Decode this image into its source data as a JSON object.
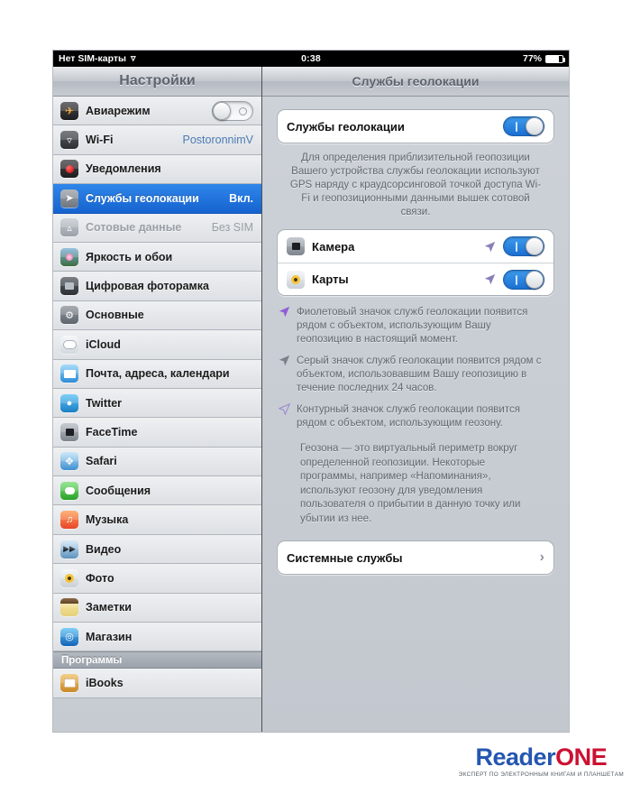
{
  "statusbar": {
    "carrier": "Нет SIM-карты",
    "wifi_icon": "wifi-icon",
    "time": "0:38",
    "battery_percent": "77%"
  },
  "sidebar": {
    "title": "Настройки",
    "items": [
      {
        "label": "Авиарежим",
        "icon": "airplane-icon",
        "control": "toggle",
        "toggle_on": false
      },
      {
        "label": "Wi-Fi",
        "icon": "wifi-icon",
        "value": "PostoronnimV"
      },
      {
        "label": "Уведомления",
        "icon": "notifications-icon"
      },
      {
        "label": "Службы геолокации",
        "icon": "location-icon",
        "value": "Вкл.",
        "selected": true
      },
      {
        "label": "Сотовые данные",
        "icon": "cellular-icon",
        "value": "Без SIM",
        "disabled": true
      },
      {
        "label": "Яркость и обои",
        "icon": "brightness-icon"
      },
      {
        "label": "Цифровая фоторамка",
        "icon": "picture-frame-icon"
      },
      {
        "label": "Основные",
        "icon": "general-gear-icon"
      },
      {
        "label": "iCloud",
        "icon": "icloud-icon"
      },
      {
        "label": "Почта, адреса, календари",
        "icon": "mail-icon"
      },
      {
        "label": "Twitter",
        "icon": "twitter-icon"
      },
      {
        "label": "FaceTime",
        "icon": "facetime-icon"
      },
      {
        "label": "Safari",
        "icon": "safari-icon"
      },
      {
        "label": "Сообщения",
        "icon": "messages-icon"
      },
      {
        "label": "Музыка",
        "icon": "music-icon"
      },
      {
        "label": "Видео",
        "icon": "video-icon"
      },
      {
        "label": "Фото",
        "icon": "photos-icon"
      },
      {
        "label": "Заметки",
        "icon": "notes-icon"
      },
      {
        "label": "Магазин",
        "icon": "store-icon"
      }
    ],
    "group_header": "Программы",
    "apps": [
      {
        "label": "iBooks",
        "icon": "ibooks-icon"
      }
    ]
  },
  "detail": {
    "title": "Службы геолокации",
    "master_row": {
      "label": "Службы геолокации",
      "toggle_on": true
    },
    "description": "Для определения приблизительной геопозиции Вашего устройства службы геолокации используют GPS наряду с краудсорсинговой точкой доступа Wi-Fi и геопозиционными данными вышек сотовой связи.",
    "app_rows": [
      {
        "label": "Камера",
        "icon": "camera-icon",
        "indicator": "location-arrow-purple",
        "toggle_on": true
      },
      {
        "label": "Карты",
        "icon": "maps-icon",
        "indicator": "location-arrow-purple",
        "toggle_on": true
      }
    ],
    "bullets": [
      {
        "indicator": "location-arrow-purple-filled",
        "text": "Фиолетовый значок служб геолокации появится рядом с объектом, использующим Вашу геопозицию в настоящий момент."
      },
      {
        "indicator": "location-arrow-gray-filled",
        "text": "Серый значок служб геолокации появится рядом с объектом, использовавшим Вашу геопозицию в течение последних 24 часов."
      },
      {
        "indicator": "location-arrow-outline",
        "text": "Контурный значок служб геолокации появится рядом с объектом, использующим геозону."
      }
    ],
    "geofence_note": "Геозона — это виртуальный периметр вокруг определенной геопозиции. Некоторые программы, например «Напоминания», используют геозону для уведомления пользователя о прибытии в данную точку или убытии из нее.",
    "system_services": {
      "label": "Системные службы",
      "chevron": "chevron-right-icon"
    }
  },
  "watermark": {
    "brand_first": "Reader",
    "brand_second": "ONE",
    "tagline": "ЭКСПЕРТ ПО ЭЛЕКТРОННЫМ КНИГАМ И ПЛАНШЕТАМ"
  },
  "colors": {
    "selection_blue": "#1663cf",
    "toggle_on_blue": "#1b6fd1",
    "value_blue": "#4e7bb5",
    "brand_blue": "#2556b0",
    "brand_red": "#cc1133"
  }
}
